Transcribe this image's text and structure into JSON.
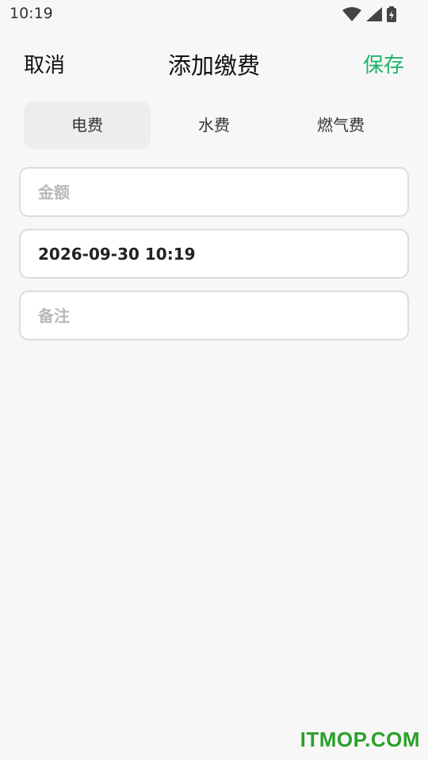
{
  "status_bar": {
    "time": "10:19",
    "icons": [
      "wifi-icon",
      "signal-icon",
      "battery-icon"
    ]
  },
  "header": {
    "cancel_label": "取消",
    "title": "添加缴费",
    "save_label": "保存",
    "accent_color": "#1db46a"
  },
  "tabs": [
    {
      "label": "电费",
      "active": true
    },
    {
      "label": "水费",
      "active": false
    },
    {
      "label": "燃气费",
      "active": false
    }
  ],
  "form": {
    "amount": {
      "value": "",
      "placeholder": "金额"
    },
    "datetime": {
      "value": "2026-09-30 10:19"
    },
    "note": {
      "value": "",
      "placeholder": "备注"
    }
  },
  "watermark": "ITMOP.COM"
}
